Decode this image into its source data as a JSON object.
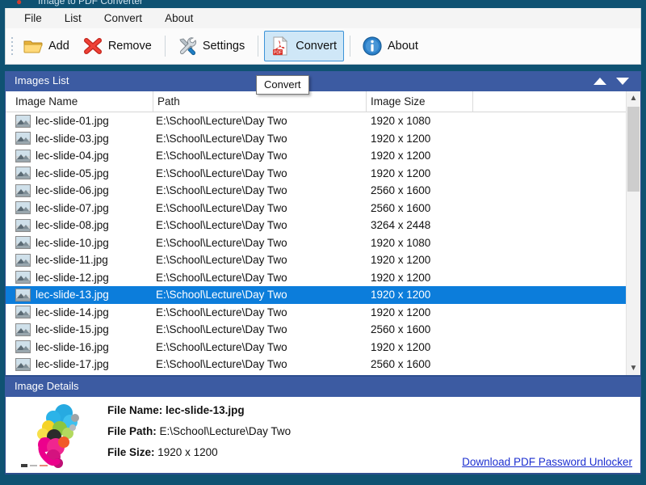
{
  "window": {
    "title": "Image to PDF Converter",
    "frame_color": "#0f5272"
  },
  "menubar": {
    "items": [
      {
        "label": "File"
      },
      {
        "label": "List"
      },
      {
        "label": "Convert"
      },
      {
        "label": "About"
      }
    ]
  },
  "toolbar": {
    "buttons": [
      {
        "label": "Add",
        "icon": "folder-open-icon",
        "active": false
      },
      {
        "label": "Remove",
        "icon": "red-x-icon",
        "active": false
      },
      {
        "label": "Settings",
        "icon": "wrench-screwdriver-icon",
        "active": false
      },
      {
        "label": "Convert",
        "icon": "pdf-icon",
        "active": true
      },
      {
        "label": "About",
        "icon": "info-icon",
        "active": false
      }
    ]
  },
  "tooltip": {
    "text": "Convert"
  },
  "images_list": {
    "title": "Images List",
    "move_up_label": "Move Up",
    "move_down_label": "Move Down",
    "columns": [
      {
        "label": "Image Name"
      },
      {
        "label": "Path"
      },
      {
        "label": "Image Size"
      },
      {
        "label": ""
      }
    ],
    "rows": [
      {
        "name": "lec-slide-01.jpg",
        "path": "E:\\School\\Lecture\\Day Two",
        "size": "1920 x 1080",
        "selected": false
      },
      {
        "name": "lec-slide-03.jpg",
        "path": "E:\\School\\Lecture\\Day Two",
        "size": "1920 x 1200",
        "selected": false
      },
      {
        "name": "lec-slide-04.jpg",
        "path": "E:\\School\\Lecture\\Day Two",
        "size": "1920 x 1200",
        "selected": false
      },
      {
        "name": "lec-slide-05.jpg",
        "path": "E:\\School\\Lecture\\Day Two",
        "size": "1920 x 1200",
        "selected": false
      },
      {
        "name": "lec-slide-06.jpg",
        "path": "E:\\School\\Lecture\\Day Two",
        "size": "2560 x 1600",
        "selected": false
      },
      {
        "name": "lec-slide-07.jpg",
        "path": "E:\\School\\Lecture\\Day Two",
        "size": "2560 x 1600",
        "selected": false
      },
      {
        "name": "lec-slide-08.jpg",
        "path": "E:\\School\\Lecture\\Day Two",
        "size": "3264 x 2448",
        "selected": false
      },
      {
        "name": "lec-slide-10.jpg",
        "path": "E:\\School\\Lecture\\Day Two",
        "size": "1920 x 1080",
        "selected": false
      },
      {
        "name": "lec-slide-11.jpg",
        "path": "E:\\School\\Lecture\\Day Two",
        "size": "1920 x 1200",
        "selected": false
      },
      {
        "name": "lec-slide-12.jpg",
        "path": "E:\\School\\Lecture\\Day Two",
        "size": "1920 x 1200",
        "selected": false
      },
      {
        "name": "lec-slide-13.jpg",
        "path": "E:\\School\\Lecture\\Day Two",
        "size": "1920 x 1200",
        "selected": true
      },
      {
        "name": "lec-slide-14.jpg",
        "path": "E:\\School\\Lecture\\Day Two",
        "size": "1920 x 1200",
        "selected": false
      },
      {
        "name": "lec-slide-15.jpg",
        "path": "E:\\School\\Lecture\\Day Two",
        "size": "2560 x 1600",
        "selected": false
      },
      {
        "name": "lec-slide-16.jpg",
        "path": "E:\\School\\Lecture\\Day Two",
        "size": "1920 x 1200",
        "selected": false
      },
      {
        "name": "lec-slide-17.jpg",
        "path": "E:\\School\\Lecture\\Day Two",
        "size": "2560 x 1600",
        "selected": false
      }
    ]
  },
  "image_details": {
    "title": "Image Details",
    "file_name_label": "File Name:",
    "file_name_value": "lec-slide-13.jpg",
    "file_path_label": "File Path:",
    "file_path_value": "E:\\School\\Lecture\\Day Two",
    "file_size_label": "File Size:",
    "file_size_value": "1920 x 1200",
    "preview_alt": "infographic-thumbnail",
    "ad_link": "Download PDF Password Unlocker"
  },
  "colors": {
    "frame": "#0f5272",
    "panel_header": "#3c5ba2",
    "selection": "#0c7ddb",
    "toolbar_active": "#cfe7f7",
    "link": "#1c2fd0"
  }
}
